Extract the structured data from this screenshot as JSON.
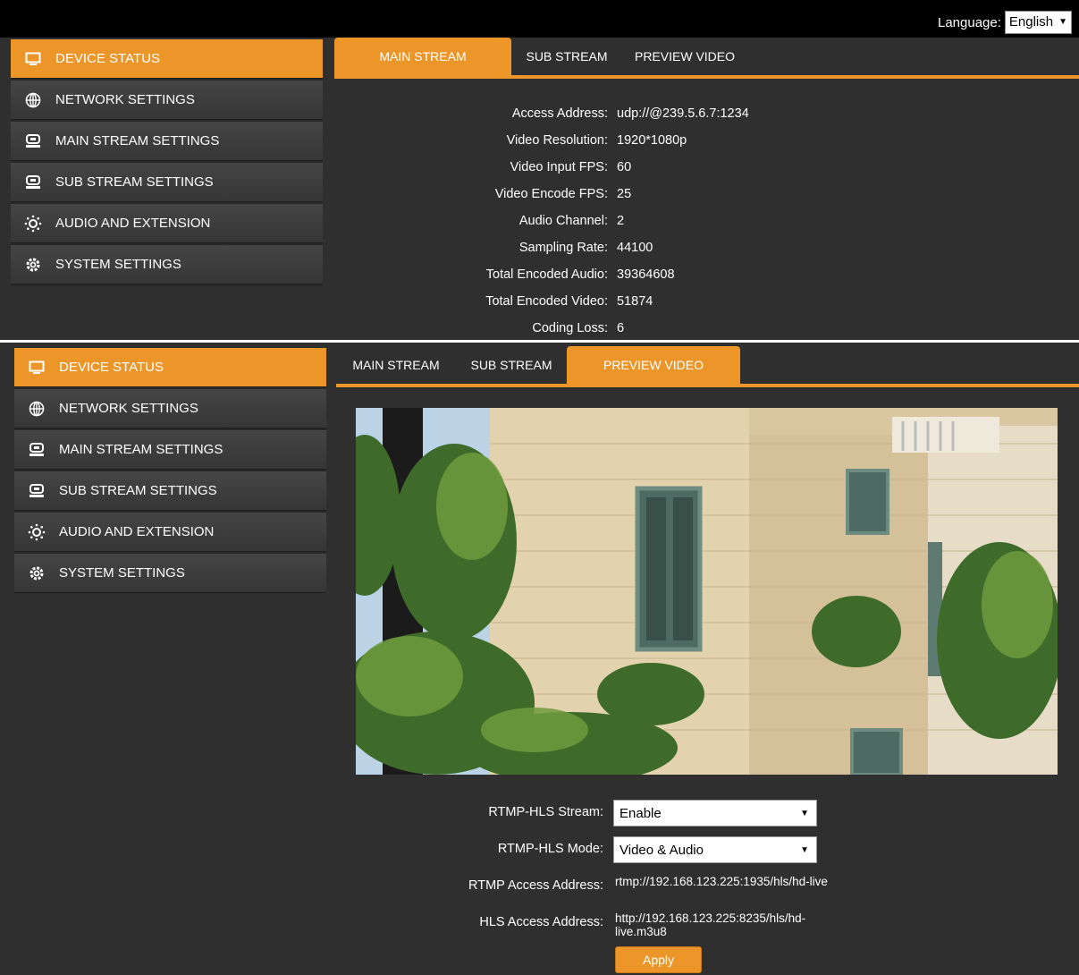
{
  "language": {
    "label": "Language:",
    "value": "English"
  },
  "sidebar": {
    "items": [
      {
        "label": "DEVICE STATUS",
        "icon": "monitor-icon"
      },
      {
        "label": "NETWORK SETTINGS",
        "icon": "globe-icon"
      },
      {
        "label": "MAIN STREAM SETTINGS",
        "icon": "hard-drive-icon"
      },
      {
        "label": "SUB STREAM SETTINGS",
        "icon": "hard-drive-icon"
      },
      {
        "label": "AUDIO AND EXTENSION",
        "icon": "sun-icon"
      },
      {
        "label": "SYSTEM SETTINGS",
        "icon": "gear-icon"
      }
    ]
  },
  "tabs": [
    "MAIN STREAM",
    "SUB STREAM",
    "PREVIEW VIDEO"
  ],
  "status": [
    {
      "label": "Access Address:",
      "value": "udp://@239.5.6.7:1234"
    },
    {
      "label": "Video Resolution:",
      "value": "1920*1080p"
    },
    {
      "label": "Video Input FPS:",
      "value": "60"
    },
    {
      "label": "Video Encode FPS:",
      "value": "25"
    },
    {
      "label": "Audio Channel:",
      "value": "2"
    },
    {
      "label": "Sampling Rate:",
      "value": "44100"
    },
    {
      "label": "Total Encoded Audio:",
      "value": "39364608"
    },
    {
      "label": "Total Encoded Video:",
      "value": "51874"
    },
    {
      "label": "Coding Loss:",
      "value": "6"
    }
  ],
  "preview": {
    "rtmp_hls_stream": {
      "label": "RTMP-HLS Stream:",
      "value": "Enable"
    },
    "rtmp_hls_mode": {
      "label": "RTMP-HLS Mode:",
      "value": "Video & Audio"
    },
    "rtmp_access": {
      "label": "RTMP Access Address:",
      "value": "rtmp://192.168.123.225:1935/hls/hd-live"
    },
    "hls_access": {
      "label": "HLS Access Address:",
      "value": "http://192.168.123.225:8235/hls/hd-live.m3u8"
    },
    "apply_label": "Apply"
  },
  "colors": {
    "accent": "#ec962a",
    "panel": "#2f2f2f",
    "sidebar": "#3c3c3c"
  }
}
